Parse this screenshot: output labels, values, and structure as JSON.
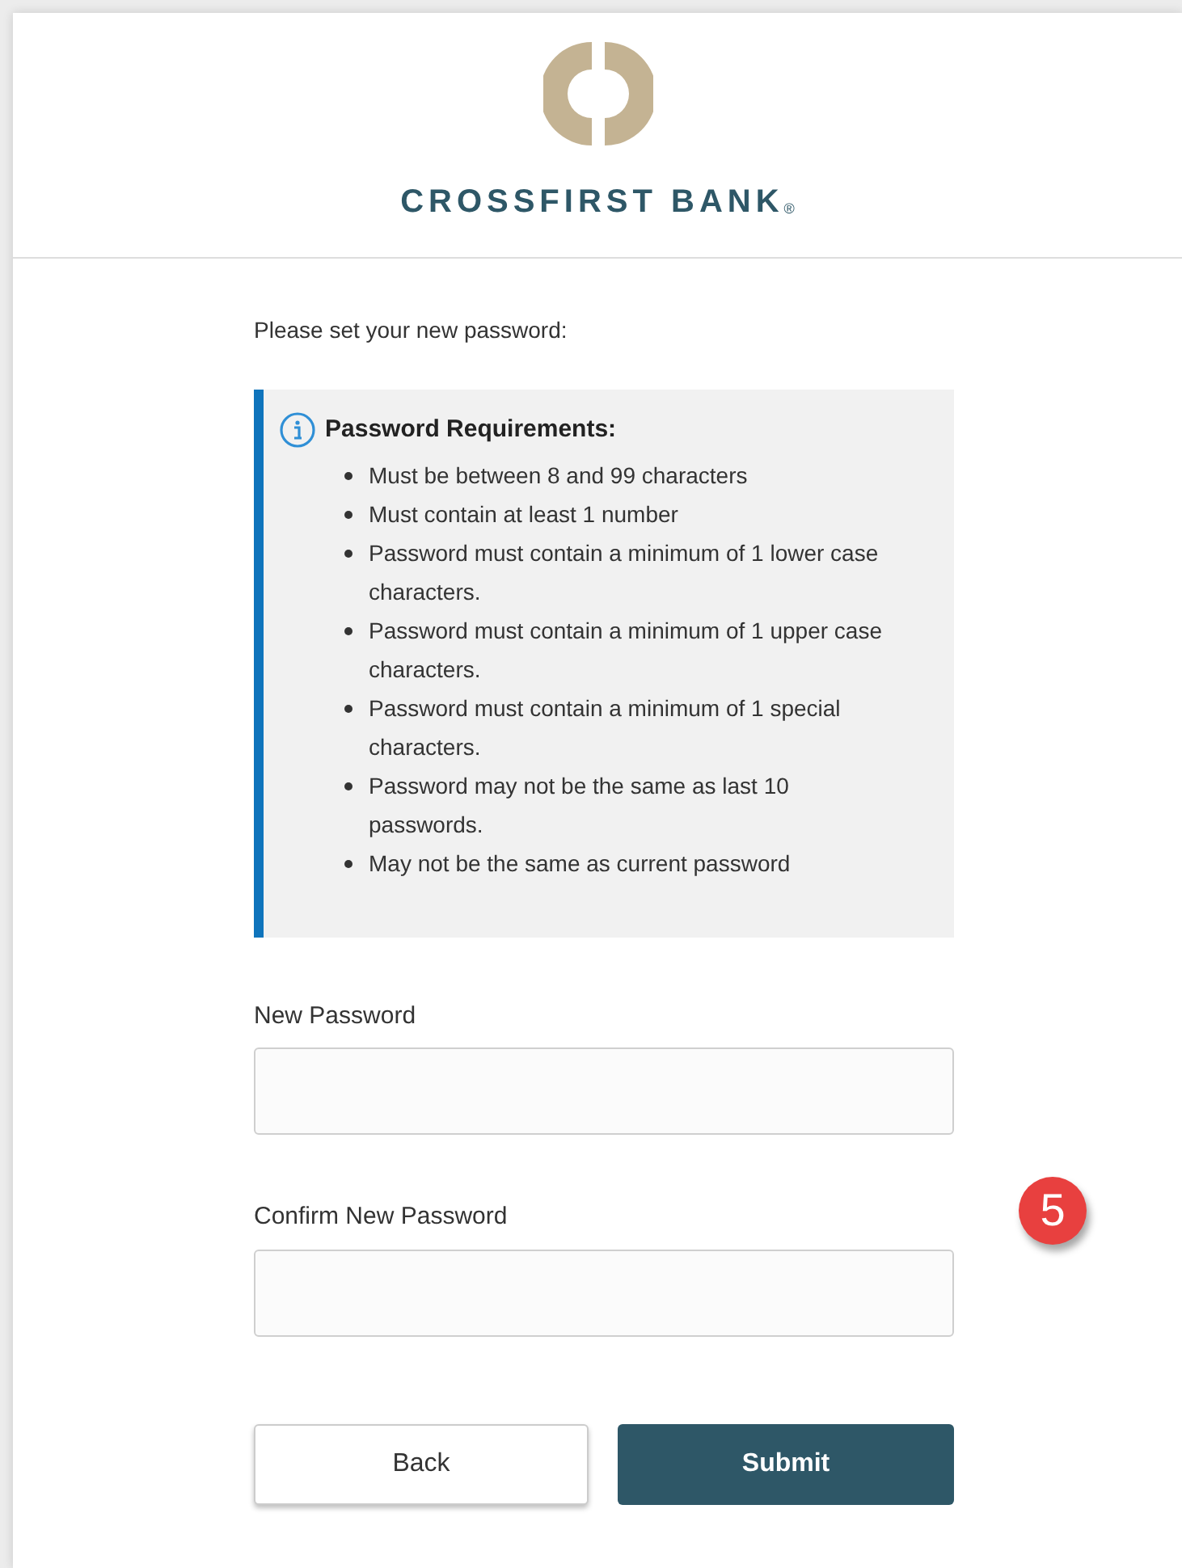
{
  "header": {
    "brand": "CROSSFIRST BANK",
    "registered_mark": "®"
  },
  "prompt": "Please set your new password:",
  "requirements": {
    "title": "Password Requirements:",
    "items": [
      "Must be between 8 and 99 characters",
      "Must contain at least 1 number",
      "Password must contain a minimum of 1 lower case characters.",
      "Password must contain a minimum of 1 upper case characters.",
      "Password must contain a minimum of 1 special characters.",
      "Password may not be the same as last 10 passwords.",
      "May not be the same as current password"
    ]
  },
  "fields": [
    {
      "label": "New Password"
    },
    {
      "label": "Confirm New Password"
    }
  ],
  "step_badge": "5",
  "buttons": [
    {
      "label": "Back",
      "kind": "secondary"
    },
    {
      "label": "Submit",
      "kind": "primary"
    }
  ]
}
